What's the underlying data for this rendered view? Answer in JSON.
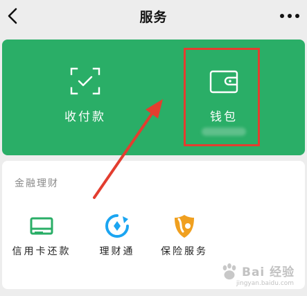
{
  "nav": {
    "title": "服务"
  },
  "payments": [
    {
      "label": "收付款",
      "icon": "scan-pay-icon"
    },
    {
      "label": "钱包",
      "icon": "wallet-icon"
    }
  ],
  "finance": {
    "section_title": "金融理财",
    "items": [
      {
        "label": "信用卡还款",
        "icon": "credit-card-icon"
      },
      {
        "label": "理财通",
        "icon": "licaitong-icon"
      },
      {
        "label": "保险服务",
        "icon": "insurance-icon"
      }
    ]
  },
  "watermark": {
    "text": "Bai 经验",
    "url": "jingyan.baidu.com"
  },
  "colors": {
    "brand_green": "#2aae67",
    "annotation_red": "#e33d2f",
    "icon_blue": "#1ba5f1",
    "icon_orange": "#f0a020"
  }
}
